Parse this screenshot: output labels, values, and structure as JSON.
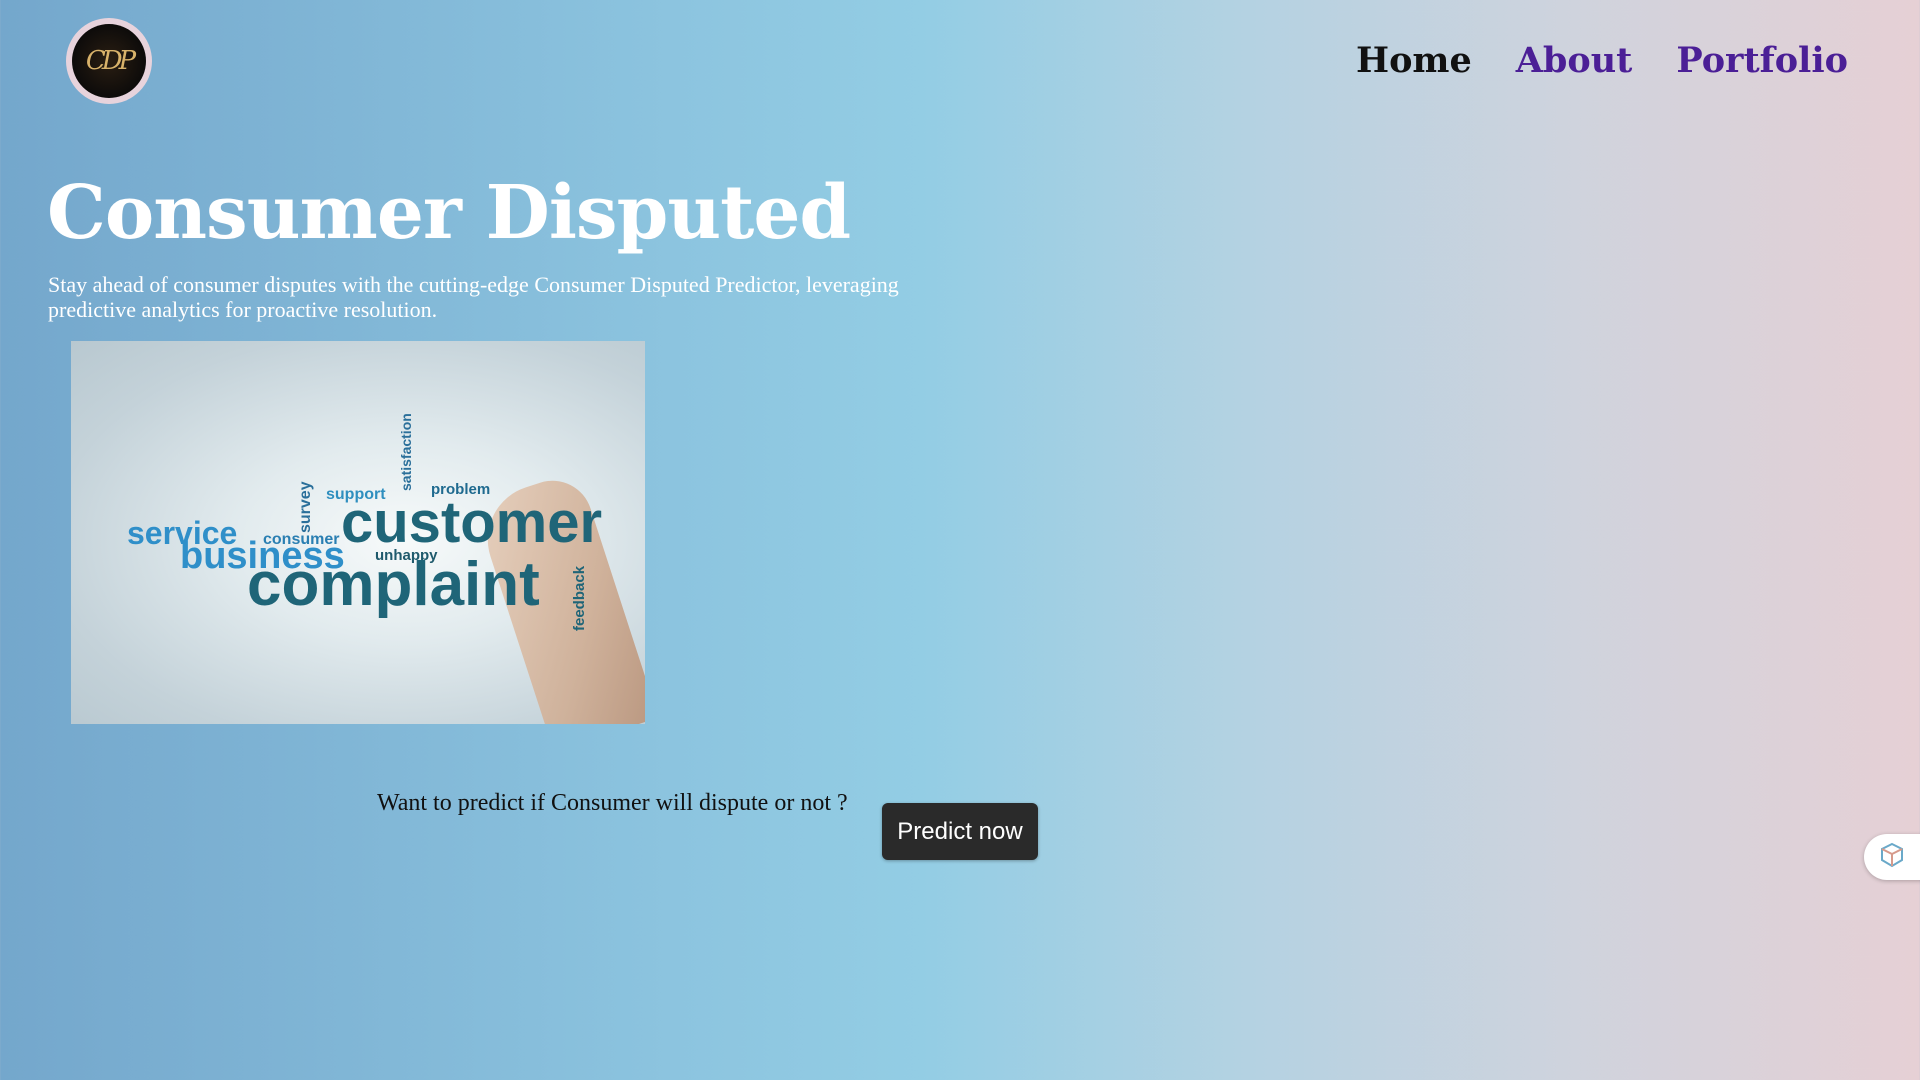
{
  "logo": {
    "text": "CDP"
  },
  "nav": {
    "items": [
      {
        "label": "Home",
        "active": true
      },
      {
        "label": "About",
        "active": false
      },
      {
        "label": "Portfolio",
        "active": false
      }
    ]
  },
  "hero": {
    "title": "Consumer Disputed",
    "subtitle": "Stay ahead of consumer disputes with the cutting-edge Consumer Disputed Predictor, leveraging predictive analytics for proactive resolution."
  },
  "image": {
    "words": {
      "customer": "customer",
      "complaint": "complaint",
      "business": "business",
      "service": "service",
      "consumer": "consumer",
      "support": "support",
      "problem": "problem",
      "unhappy": "unhappy",
      "feedback": "feedback",
      "satisfaction": "satisfaction",
      "survey": "survey"
    }
  },
  "cta": {
    "text": "Want to predict if Consumer will dispute or not ?",
    "button_label": "Predict now"
  },
  "colors": {
    "nav_link": "#4b1f96",
    "nav_active": "#111111",
    "button_bg": "#2a2a2a"
  },
  "icons": {
    "side_widget": "cube-icon"
  }
}
